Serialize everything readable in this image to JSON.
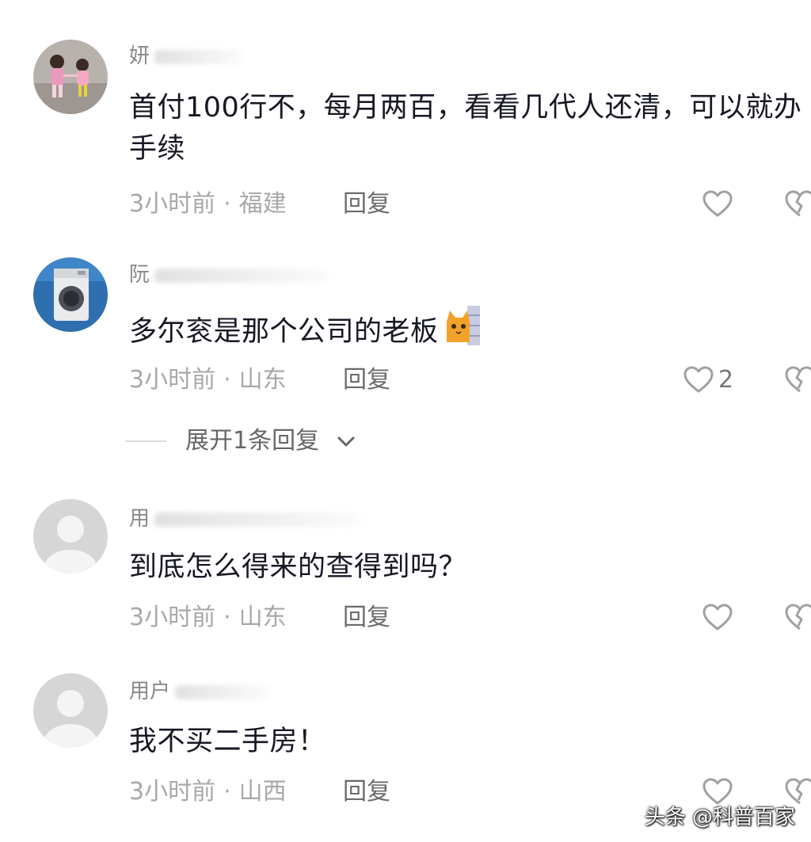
{
  "comments": [
    {
      "username": "妍",
      "content": "首付100行不，每月两百，看看几代人还清，可以就办手续",
      "time": "3小时前",
      "location": "福建",
      "reply_label": "回复",
      "like_count": "",
      "avatar_icon": "avatar-two-girls-icon"
    },
    {
      "username": "阮",
      "content": "多尔衮是那个公司的老板",
      "emoji": "cat-peeking-emoji",
      "time": "3小时前",
      "location": "山东",
      "reply_label": "回复",
      "like_count": "2",
      "avatar_icon": "avatar-washing-machine-icon"
    },
    {
      "username": "用",
      "content": "到底怎么得来的查得到吗？",
      "time": "3小时前",
      "location": "山东",
      "reply_label": "回复",
      "like_count": "",
      "avatar_icon": "default-avatar-icon"
    },
    {
      "username": "用户",
      "content": "我不买二手房！",
      "time": "3小时前",
      "location": "山西",
      "reply_label": "回复",
      "like_count": "",
      "avatar_icon": "default-avatar-icon"
    }
  ],
  "expand_replies": {
    "label": "展开1条回复"
  },
  "watermark": "头条 @科普百家",
  "colors": {
    "text": "#161823",
    "meta": "#a8a8a8",
    "reply": "#6b6b6b",
    "icon": "#a0a0a0",
    "default_avatar_bg": "#d6d6d6"
  }
}
